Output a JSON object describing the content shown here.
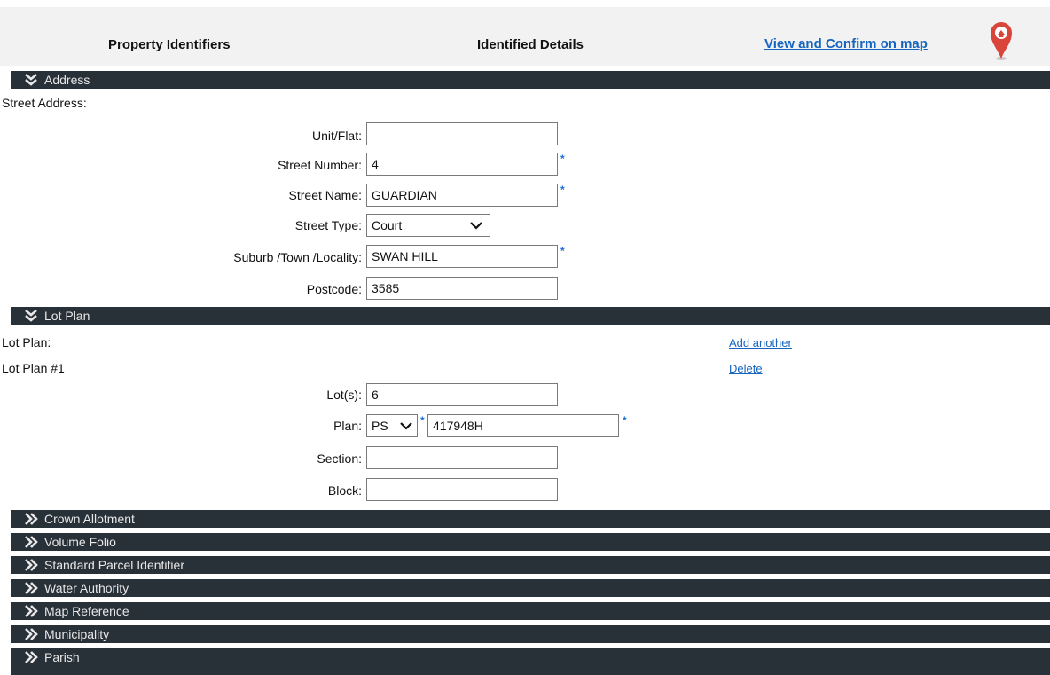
{
  "header": {
    "col1": "Property Identifiers",
    "col2": "Identified Details",
    "map_link": "View and Confirm on map"
  },
  "address": {
    "title": "Address",
    "street_address_label": "Street Address:",
    "fields": {
      "unit_label": "Unit/Flat:",
      "unit_value": "",
      "street_number_label": "Street Number:",
      "street_number_value": "4",
      "street_name_label": "Street Name:",
      "street_name_value": "GUARDIAN",
      "street_type_label": "Street Type:",
      "street_type_value": "Court",
      "suburb_label": "Suburb /Town /Locality:",
      "suburb_value": "SWAN HILL",
      "postcode_label": "Postcode:",
      "postcode_value": "3585"
    }
  },
  "lot_plan": {
    "title": "Lot Plan",
    "lot_plan_label": "Lot Plan:",
    "add_another": "Add another",
    "entry_label": "Lot Plan #1",
    "delete": "Delete",
    "lots_label": "Lot(s):",
    "lots_value": "6",
    "plan_label": "Plan:",
    "plan_prefix": "PS",
    "plan_value": "417948H",
    "section_label": "Section:",
    "section_value": "",
    "block_label": "Block:",
    "block_value": ""
  },
  "required_marker": "*",
  "collapsed_sections": [
    "Crown Allotment",
    "Volume Folio",
    "Standard Parcel Identifier",
    "Water Authority",
    "Map Reference",
    "Municipality",
    "Parish"
  ],
  "colors": {
    "section_bar": "#283038",
    "link": "#1565c0",
    "required": "#1e6fd9",
    "map_pin": "#d9443b"
  }
}
